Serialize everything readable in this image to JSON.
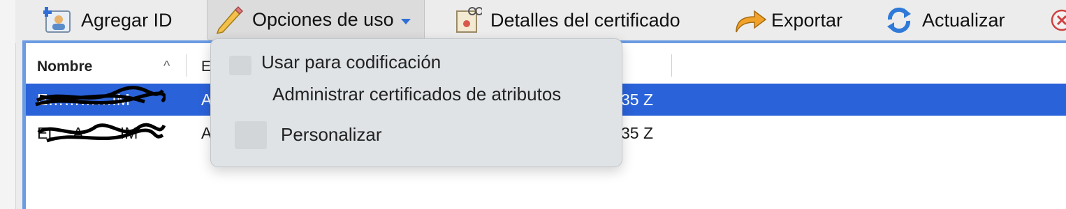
{
  "toolbar": {
    "items": [
      {
        "label": "Agregar ID",
        "icon": "add-id-icon"
      },
      {
        "label": "Opciones de uso",
        "icon": "pencil-icon"
      },
      {
        "label": "Detalles del certificado",
        "icon": "certificate-icon"
      },
      {
        "label": "Exportar",
        "icon": "export-arrow-icon"
      },
      {
        "label": "Actualizar",
        "icon": "refresh-icon"
      },
      {
        "label": "",
        "icon": "delete-icon"
      }
    ]
  },
  "table": {
    "columns": [
      {
        "label": "Nombre",
        "sort": "^"
      },
      {
        "label": "E"
      }
    ],
    "rows": [
      {
        "name": "E…………IM",
        "col2": "A",
        "col3": "35 Z",
        "selected": true
      },
      {
        "name": "EL…A…….IM",
        "col2": "A",
        "col3": "35 Z",
        "selected": false
      }
    ]
  },
  "menu": {
    "items": [
      {
        "label": "Usar para codificación",
        "icon": "lock-icon"
      },
      {
        "label": "Administrar certificados de atributos",
        "icon": ""
      },
      {
        "label": "Personalizar",
        "icon": "document-icon"
      }
    ]
  },
  "colors": {
    "selection": "#2a62d9",
    "caret": "#2f6fd6",
    "menu_bg": "#dfe3e6"
  }
}
